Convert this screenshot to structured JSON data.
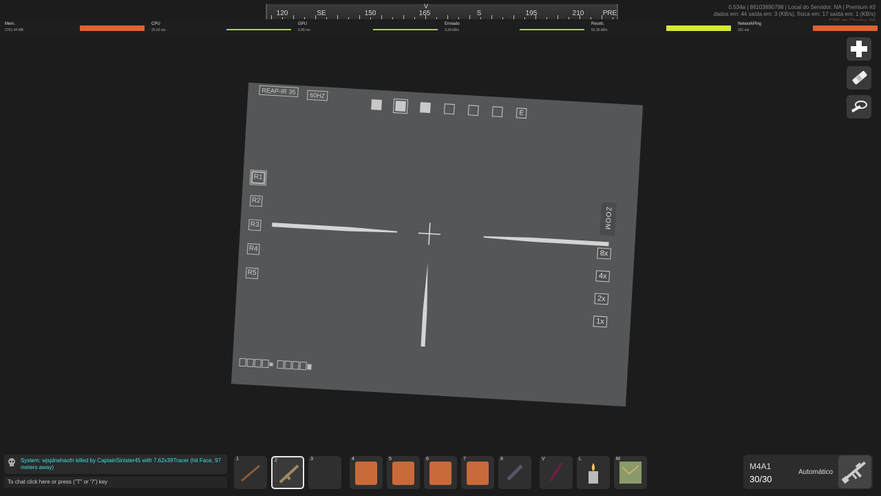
{
  "compass": {
    "labels": [
      "120",
      "SE",
      "150",
      "165",
      "S",
      "195",
      "210",
      "PRE"
    ],
    "heading_marker": "V"
  },
  "server_info": {
    "line1": "0.534a | 86103890798 | Local do Servidor: NA | Premium #3",
    "line2": "dados em: 44 saída em: 3 (KB/s), física em: 17 saída em: 1 (KB/s)",
    "line3": "FPS do Cliente: 56"
  },
  "stats": [
    {
      "name": "Mem.",
      "value": "2701.44 MB",
      "color": "#e0622e",
      "kind": "bar"
    },
    {
      "name": "CPU",
      "value": "25.62 ms",
      "color": "#a8d83a",
      "kind": "line"
    },
    {
      "name": "GPU",
      "value": "5.96 ms",
      "color": "#a8d83a",
      "kind": "line"
    },
    {
      "name": "Enviado",
      "value": "3.30 kB/s",
      "color": "#a8d83a",
      "kind": "line"
    },
    {
      "name": "Receb.",
      "value": "62.35 kB/s",
      "color": "#d8e83a",
      "kind": "bar"
    },
    {
      "name": "NetworkPing",
      "value": "201 ms",
      "color": "#e0622e",
      "kind": "bar"
    }
  ],
  "tools": {
    "heal_icon": "plus-icon",
    "bandage_icon": "bandage-icon",
    "tourniquet_icon": "tourniquet-icon"
  },
  "scope": {
    "model": "REAP-IR 35",
    "frequency": "60HZ",
    "mode_buttons": [
      "",
      "",
      "",
      "",
      "",
      "",
      "E"
    ],
    "reticle_buttons": [
      "R1",
      "R2",
      "R3",
      "R4",
      "R5"
    ],
    "zoom_label": "ZOOM",
    "zoom_levels": [
      "8x",
      "4x",
      "2x",
      "1x"
    ]
  },
  "chat": {
    "message": "System: wjsjdnehaofn killed by CaptainSinister45 with 7.62x39Tracer (hit Face, 97 meters away)",
    "input_placeholder": "To chat click here or press (\"T\" or \"/\") key"
  },
  "hotbar": [
    {
      "key": "1",
      "item": "rifle-brown"
    },
    {
      "key": "2",
      "item": "rifle-tan",
      "selected": true
    },
    {
      "key": "3",
      "item": ""
    },
    {
      "key": "4",
      "item": "brown-bag"
    },
    {
      "key": "5",
      "item": "brown-bag"
    },
    {
      "key": "6",
      "item": "brown-bag"
    },
    {
      "key": "7",
      "item": "brown-bag"
    },
    {
      "key": "8",
      "item": "flashlight"
    },
    {
      "key": "V",
      "item": "knife"
    },
    {
      "key": "L",
      "item": "lighter"
    },
    {
      "key": "M",
      "item": "map"
    }
  ],
  "weapon": {
    "name": "M4A1",
    "ammo": "30/30",
    "fire_mode": "Automático"
  }
}
